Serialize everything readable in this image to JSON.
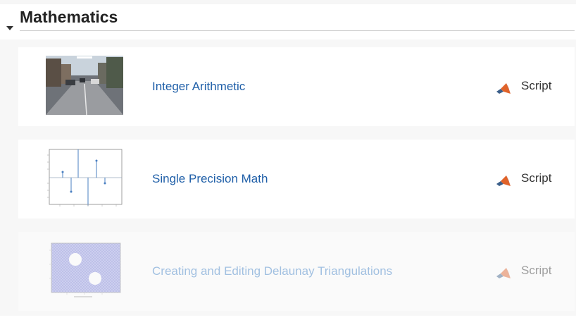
{
  "section": {
    "title": "Mathematics"
  },
  "examples": [
    {
      "title": "Integer Arithmetic",
      "type": "Script",
      "thumb_icon": "street-photo-thumbnail",
      "enabled": true
    },
    {
      "title": "Single Precision Math",
      "type": "Script",
      "thumb_icon": "stem-plot-thumbnail",
      "enabled": true
    },
    {
      "title": "Creating and Editing Delaunay Triangulations",
      "type": "Script",
      "thumb_icon": "triangulation-mesh-thumbnail",
      "enabled": false
    }
  ],
  "colors": {
    "link": "#1f5fa8",
    "card_bg": "#ffffff",
    "list_bg": "#f7f7f7",
    "rule": "#cfcfcf"
  }
}
